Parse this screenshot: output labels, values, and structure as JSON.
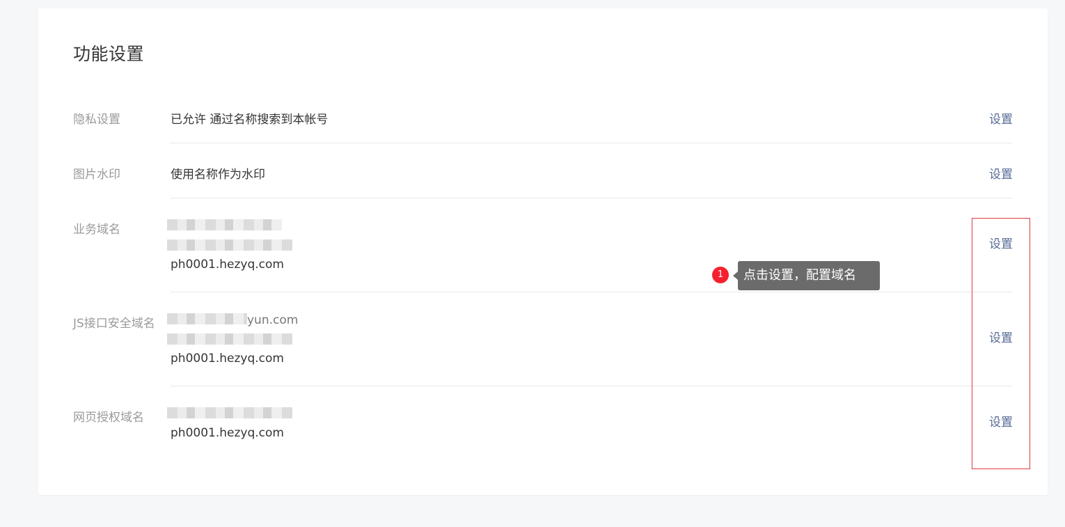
{
  "page": {
    "title": "功能设置"
  },
  "rows": [
    {
      "label": "隐私设置",
      "value": "已允许 通过名称搜索到本帐号",
      "action": "设置"
    },
    {
      "label": "图片水印",
      "value": "使用名称作为水印",
      "action": "设置"
    },
    {
      "label": "业务域名",
      "visible_domain": "ph0001.hezyq.com",
      "action": "设置"
    },
    {
      "label": "JS接口安全域名",
      "visible_domain": "ph0001.hezyq.com",
      "partial_text": "yun.com",
      "action": "设置"
    },
    {
      "label": "网页授权域名",
      "visible_domain": "ph0001.hezyq.com",
      "action": "设置"
    }
  ],
  "annotation": {
    "step_number": "1",
    "tooltip_text": "点击设置，配置域名",
    "highlight_color": "#e0393e"
  },
  "colors": {
    "link": "#576b95",
    "label": "#9a9a9a",
    "badge": "#f5222d",
    "tooltip_bg": "#6b6b6b"
  }
}
